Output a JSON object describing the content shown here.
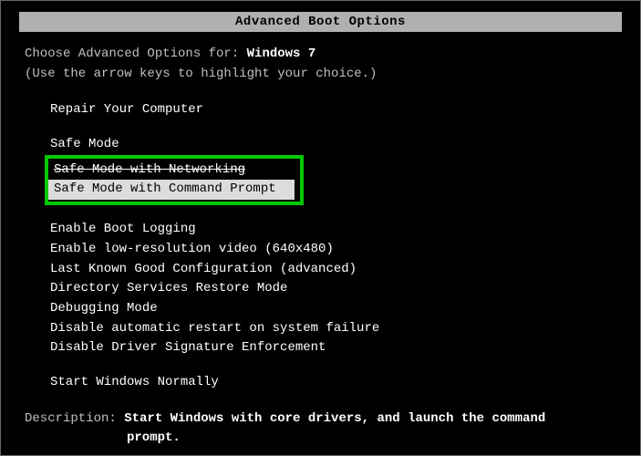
{
  "title": "Advanced Boot Options",
  "intro_prefix": "Choose Advanced Options for: ",
  "os_name": "Windows 7",
  "hint": "(Use the arrow keys to highlight your choice.)",
  "options": {
    "repair": "Repair Your Computer",
    "safe_mode": "Safe Mode",
    "safe_net": "Safe Mode with Networking",
    "safe_cmd": "Safe Mode with Command Prompt",
    "boot_log": "Enable Boot Logging",
    "low_res": "Enable low-resolution video (640x480)",
    "lkgc": "Last Known Good Configuration (advanced)",
    "dsrm": "Directory Services Restore Mode",
    "debug": "Debugging Mode",
    "no_restart": "Disable automatic restart on system failure",
    "no_sig": "Disable Driver Signature Enforcement",
    "normal": "Start Windows Normally"
  },
  "description_label": "Description: ",
  "description_line1": "Start Windows with core drivers, and launch the command",
  "description_line2": "prompt.",
  "annotation_color": "#00c800"
}
